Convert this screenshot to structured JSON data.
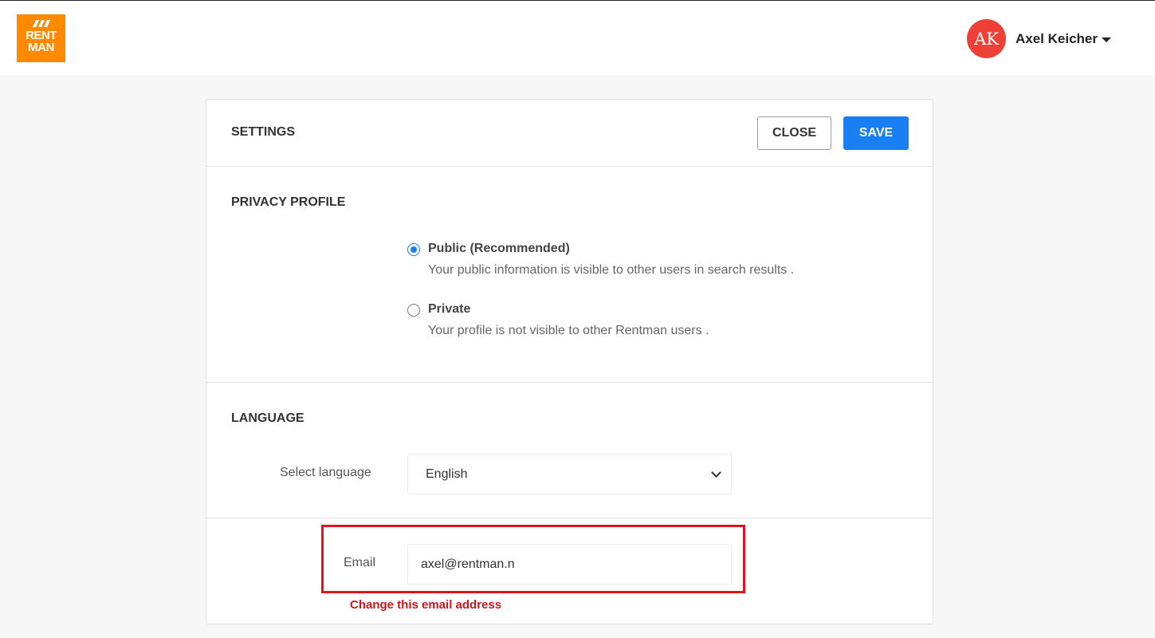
{
  "header": {
    "logo": {
      "line1": "RENT",
      "line2": "MAN",
      "icon": "rentman-logo-icon",
      "color": "#ff8a00"
    },
    "user": {
      "initials": "AK",
      "name": "Axel Keicher",
      "avatar_color": "#ee4036"
    }
  },
  "settings": {
    "title": "SETTINGS",
    "close_label": "CLOSE",
    "save_label": "SAVE",
    "accent": "#1a7ff2"
  },
  "privacy": {
    "title": "PRIVACY PROFILE",
    "options": [
      {
        "label": "Public (Recommended)",
        "desc": "Your public information is visible to other users in search results .",
        "checked": true
      },
      {
        "label": "Private",
        "desc": "Your profile is not visible to other Rentman users .",
        "checked": false
      }
    ]
  },
  "language": {
    "title": "LANGUAGE",
    "label": "Select language",
    "selected": "English"
  },
  "email": {
    "label": "Email",
    "value": "axel@rentman.n"
  },
  "annotation": {
    "text": "Change this email address",
    "color": "#e0141e"
  }
}
